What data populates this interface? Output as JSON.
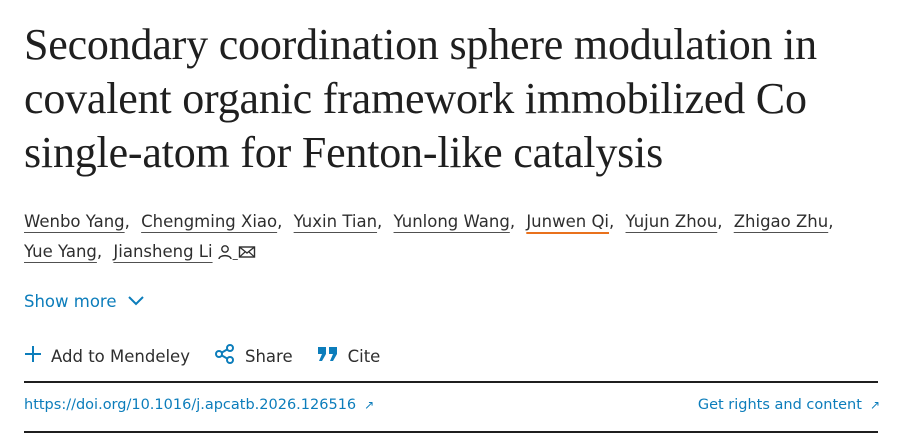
{
  "article": {
    "title": "Secondary coordination sphere modulation in covalent organic framework immobilized Co single-atom for Fenton-like catalysis"
  },
  "authors": [
    {
      "name": "Wenbo Yang"
    },
    {
      "name": "Chengming Xiao"
    },
    {
      "name": "Yuxin Tian"
    },
    {
      "name": "Yunlong Wang"
    },
    {
      "name": "Junwen Qi"
    },
    {
      "name": "Yujun Zhou"
    },
    {
      "name": "Zhigao Zhu"
    },
    {
      "name": "Yue Yang"
    },
    {
      "name": "Jiansheng Li"
    }
  ],
  "author_separator": ",",
  "show_more": {
    "label": "Show more"
  },
  "actions": {
    "add_mendeley": "Add to Mendeley",
    "share": "Share",
    "cite": "Cite"
  },
  "links": {
    "doi": "https://doi.org/10.1016/j.apcatb.2026.126516",
    "rights": "Get rights and content",
    "external_arrow": "↗"
  },
  "colors": {
    "link": "#0c7dbb",
    "highlight_underline": "#e9711c",
    "text": "#2e2e2e"
  },
  "icons": [
    "person-icon",
    "envelope-icon",
    "chevron-down-icon",
    "plus-icon",
    "share-icon",
    "quote-icon",
    "external-link-icon"
  ]
}
